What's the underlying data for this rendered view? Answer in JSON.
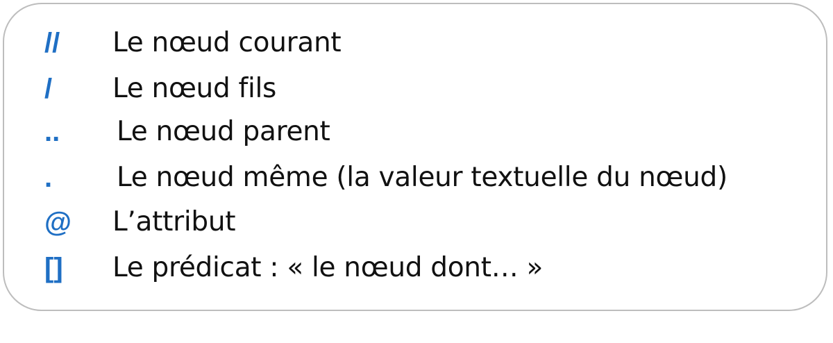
{
  "items": [
    {
      "symbol": "//",
      "label": "Le nœud courant"
    },
    {
      "symbol": "/",
      "label": "Le nœud fils"
    },
    {
      "symbol": "..",
      "label": "Le nœud parent"
    },
    {
      "symbol": ".",
      "label": "Le nœud même (la valeur textuelle du nœud)"
    },
    {
      "symbol": "@",
      "label": "L’attribut"
    },
    {
      "symbol": "[]",
      "label": "Le prédicat : « le nœud dont… »"
    }
  ],
  "colors": {
    "symbol": "#1f6fc4",
    "text": "#111111",
    "border": "#bdbdbd"
  }
}
